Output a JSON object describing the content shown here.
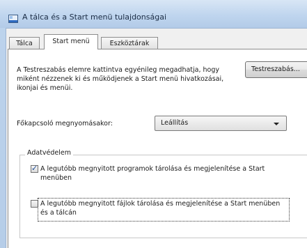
{
  "window": {
    "title": "A tálca és a Start menü tulajdonságai"
  },
  "tabs": [
    {
      "label": "Tálca",
      "active": false
    },
    {
      "label": "Start menü",
      "active": true
    },
    {
      "label": "Eszköztárak",
      "active": false
    }
  ],
  "start_menu": {
    "description": "A Testreszabás elemre kattintva egyénileg megadhatja, hogy miként nézzenek ki és működjenek a Start menü hivatkozásai, ikonjai és menüi.",
    "customize_button": "Testreszabás...",
    "power_button_label": "Főkapcsoló megnyomásakor:",
    "power_button_value": "Leállítás",
    "privacy_group_title": "Adatvédelem",
    "checkboxes": [
      {
        "label": "A legutóbb megnyitott programok tárolása és megjelenítése a Start menüben",
        "checked": true
      },
      {
        "label": "A legutóbb megnyitott fájlok tárolása és megjelenítése a Start menüben és a tálcán",
        "checked": false
      }
    ]
  },
  "icons": {
    "app": "taskbar-properties-icon",
    "checkmark": "checkmark-icon",
    "dropdown": "chevron-down-icon"
  },
  "colors": {
    "title_bar": "#bfd5ee",
    "panel": "#f0f0f0",
    "checkmark": "#1f4e9a"
  }
}
